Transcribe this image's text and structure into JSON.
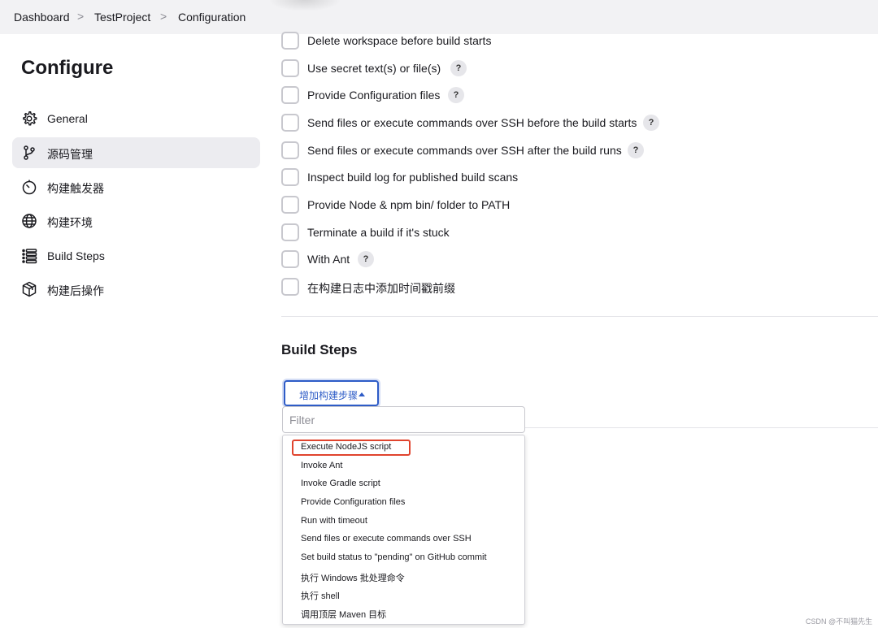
{
  "breadcrumb": {
    "items": [
      "Dashboard",
      "TestProject",
      "Configuration"
    ],
    "separator": ">"
  },
  "sidebar": {
    "title": "Configure",
    "items": [
      {
        "label": "General",
        "icon": "gear-icon",
        "active": false
      },
      {
        "label": "源码管理",
        "icon": "branch-icon",
        "active": true
      },
      {
        "label": "构建触发器",
        "icon": "timer-icon",
        "active": false
      },
      {
        "label": "构建环境",
        "icon": "globe-icon",
        "active": false
      },
      {
        "label": "Build Steps",
        "icon": "list-icon",
        "active": false
      },
      {
        "label": "构建后操作",
        "icon": "package-icon",
        "active": false
      }
    ]
  },
  "options": [
    {
      "label": "Delete workspace before build starts",
      "checked": false,
      "help": false
    },
    {
      "label": "Use secret text(s) or file(s)",
      "checked": false,
      "help": true
    },
    {
      "label": "Provide Configuration files",
      "checked": false,
      "help": true
    },
    {
      "label": "Send files or execute commands over SSH before the build starts",
      "checked": false,
      "help": true
    },
    {
      "label": "Send files or execute commands over SSH after the build runs",
      "checked": false,
      "help": true
    },
    {
      "label": "Inspect build log for published build scans",
      "checked": false,
      "help": false
    },
    {
      "label": "Provide Node & npm bin/ folder to PATH",
      "checked": false,
      "help": false
    },
    {
      "label": "Terminate a build if it's stuck",
      "checked": false,
      "help": false
    },
    {
      "label": "With Ant",
      "checked": false,
      "help": true
    },
    {
      "label": "在构建日志中添加时间戳前缀",
      "checked": false,
      "help": false
    }
  ],
  "help_symbol": "?",
  "build_steps": {
    "title": "Build Steps",
    "add_button_label": "增加构建步骤",
    "filter_placeholder": "Filter",
    "filter_value": "",
    "menu_items": [
      "Execute NodeJS script",
      "Invoke Ant",
      "Invoke Gradle script",
      "Provide Configuration files",
      "Run with timeout",
      "Send files or execute commands over SSH",
      "Set build status to \"pending\" on GitHub commit",
      "执行 Windows 批处理命令",
      "执行 shell",
      "调用顶层 Maven 目标"
    ],
    "highlighted_item": "Execute NodeJS script"
  },
  "watermark": "CSDN @不叫猫先生",
  "colors": {
    "accent": "#2e5cc7",
    "highlight_outline": "#e0442e",
    "topbar_bg": "#f2f2f4",
    "active_nav_bg": "#ececf0"
  }
}
